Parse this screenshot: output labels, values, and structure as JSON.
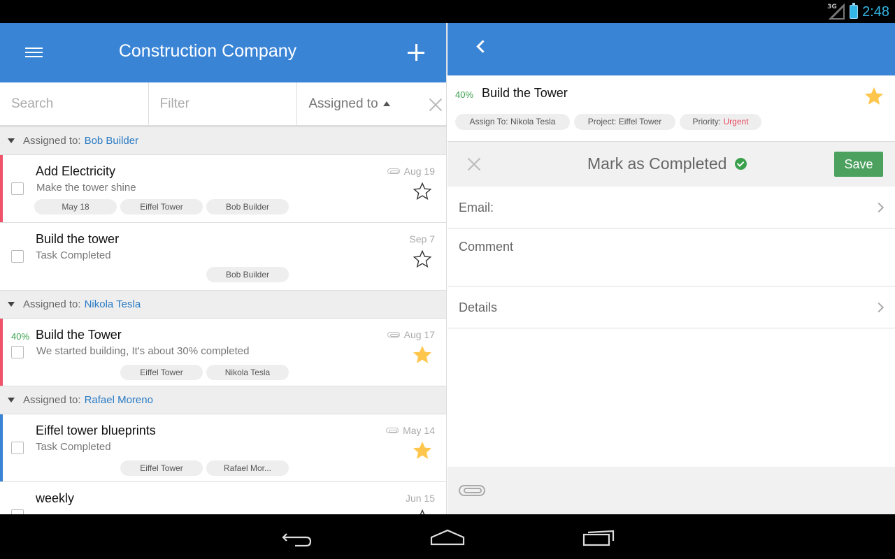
{
  "status_bar": {
    "network": "3G",
    "time": "2:48"
  },
  "left_pane": {
    "title": "Construction Company",
    "search": {
      "placeholder": "Search"
    },
    "filter": {
      "placeholder": "Filter"
    },
    "sort": {
      "label": "Assigned to"
    },
    "groups": [
      {
        "prefix": "Assigned to:",
        "name": "Bob Builder",
        "tasks": [
          {
            "title": "Add Electricity",
            "subtitle": "Make the tower shine",
            "date": "Aug 19",
            "attachment": true,
            "starred": false,
            "tags": [
              "May 18",
              "Eiffel Tower",
              "Bob Builder"
            ],
            "bar_color": "#f0526a"
          },
          {
            "title": "Build the tower",
            "subtitle": "Task Completed",
            "date": "Sep 7",
            "attachment": false,
            "starred": false,
            "tags": [
              "",
              "",
              "Bob Builder"
            ],
            "bar_color": ""
          }
        ]
      },
      {
        "prefix": "Assigned to:",
        "name": "Nikola Tesla",
        "tasks": [
          {
            "progress": "40%",
            "title": "Build the Tower",
            "subtitle": "We started building, It's about 30% completed",
            "date": "Aug 17",
            "attachment": true,
            "starred": true,
            "tags": [
              "",
              "Eiffel Tower",
              "Nikola Tesla"
            ],
            "bar_color": "#f0526a"
          }
        ]
      },
      {
        "prefix": "Assigned to:",
        "name": "Rafael Moreno",
        "tasks": [
          {
            "title": "Eiffel tower blueprints",
            "subtitle": "Task Completed",
            "date": "May 14",
            "attachment": true,
            "starred": true,
            "tags": [
              "",
              "Eiffel Tower",
              "Rafael Mor..."
            ],
            "bar_color": "#3a84d6"
          },
          {
            "title": "weekly",
            "subtitle": "",
            "date": "Jun 15",
            "attachment": false,
            "starred": false,
            "tags": [
              "",
              "",
              ""
            ],
            "bar_color": ""
          }
        ]
      }
    ]
  },
  "right_pane": {
    "task": {
      "progress": "40%",
      "title": "Build the Tower",
      "starred": true,
      "chips": {
        "assign_prefix": "Assign To:",
        "assign_value": "Nikola Tesla",
        "project_prefix": "Project:",
        "project_value": "Eiffel Tower",
        "priority_prefix": "Priority:",
        "priority_value": "Urgent"
      }
    },
    "complete_bar": {
      "label": "Mark as Completed",
      "save_label": "Save"
    },
    "fields": {
      "email": "Email:",
      "comment": "Comment",
      "details": "Details"
    }
  },
  "colors": {
    "accent": "#3a84d6",
    "star": "#ffc64d",
    "green": "#3aa04b",
    "urgent": "#e84a5f",
    "save": "#4ca15f"
  },
  "icons": [
    "menu-icon",
    "add-icon",
    "clear-icon",
    "back-icon",
    "star-icon",
    "attachment-icon",
    "check-circle-icon",
    "close-icon",
    "chevron-right-icon",
    "nav-back-icon",
    "nav-home-icon",
    "nav-recent-icon"
  ]
}
